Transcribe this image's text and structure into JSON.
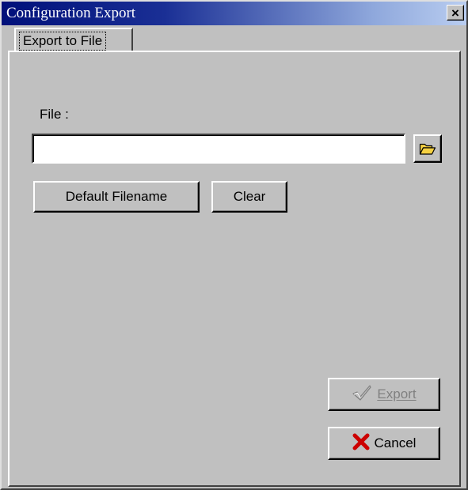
{
  "window": {
    "title": "Configuration Export",
    "close_glyph": "×"
  },
  "tabs": [
    {
      "label": "Export to File",
      "active": true
    }
  ],
  "file": {
    "label": "File :",
    "value": "",
    "placeholder": "",
    "browse_icon": "folder-open-icon"
  },
  "buttons": {
    "default_filename": "Default Filename",
    "clear": "Clear",
    "export": "Export",
    "export_icon": "checkmark-icon",
    "export_disabled": true,
    "cancel": "Cancel",
    "cancel_icon": "red-x-icon"
  },
  "colors": {
    "face": "#c0c0c0",
    "titlebar_start": "#00107a",
    "titlebar_end": "#b9cdf0",
    "cancel_x": "#cc0000",
    "folder": "#f5d142",
    "disabled_text": "#808080"
  }
}
